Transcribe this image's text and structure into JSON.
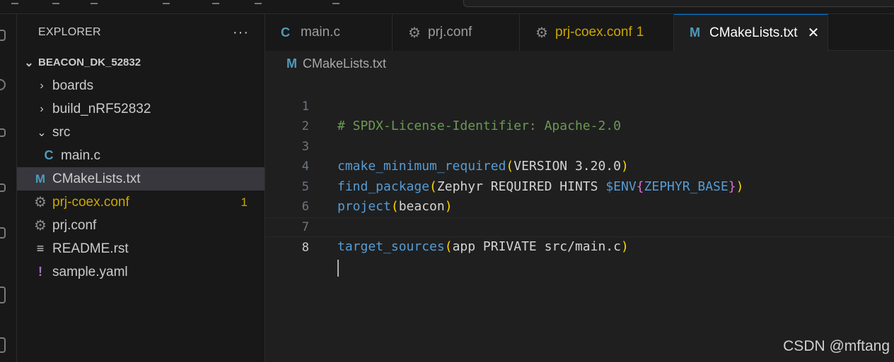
{
  "explorer": {
    "title": "EXPLORER",
    "more": "···",
    "root": "BEACON_DK_52832",
    "items": [
      {
        "label": "boards",
        "type": "folder",
        "state": "collapsed"
      },
      {
        "label": "build_nRF52832",
        "type": "folder",
        "state": "collapsed"
      },
      {
        "label": "src",
        "type": "folder",
        "state": "expanded"
      },
      {
        "label": "main.c",
        "type": "c-file",
        "icon": "C"
      },
      {
        "label": "CMakeLists.txt",
        "type": "cmake-file",
        "icon": "M",
        "selected": true
      },
      {
        "label": "prj-coex.conf",
        "type": "config-file",
        "badge": "1",
        "modified": true
      },
      {
        "label": "prj.conf",
        "type": "config-file"
      },
      {
        "label": "README.rst",
        "type": "text-file"
      },
      {
        "label": "sample.yaml",
        "type": "yaml-file",
        "icon": "!"
      }
    ]
  },
  "tabs": [
    {
      "label": "main.c",
      "icon": "C"
    },
    {
      "label": "prj.conf",
      "icon": "gear-icon"
    },
    {
      "label": "prj-coex.conf",
      "icon": "gear-icon",
      "badge": "1",
      "modified": true
    },
    {
      "label": "CMakeLists.txt",
      "icon": "M",
      "active": true,
      "close": "✕"
    }
  ],
  "breadcrumb": {
    "icon": "M",
    "file": "CMakeLists.txt"
  },
  "code": {
    "line_numbers": [
      "1",
      "2",
      "3",
      "4",
      "5",
      "6",
      "7",
      "8"
    ],
    "current_line": 8,
    "lines": [
      [
        "# SPDX-License-Identifier: Apache-2.0"
      ],
      [
        ""
      ],
      [
        "cmake_minimum_required",
        "(",
        "VERSION 3.20.0",
        ")"
      ],
      [
        "find_package",
        "(",
        "Zephyr REQUIRED HINTS ",
        "$ENV",
        "{",
        "ZEPHYR_BASE",
        "}",
        ")"
      ],
      [
        "project",
        "(",
        "beacon",
        ")"
      ],
      [
        ""
      ],
      [
        "target_sources",
        "(",
        "app PRIVATE src/main.c",
        ")"
      ],
      [
        ""
      ]
    ]
  },
  "watermark": "CSDN @mftang",
  "colors": {
    "accent": "#0078d4",
    "modified": "#cca700",
    "c_icon": "#519aba",
    "cmake_icon": "#519aba",
    "yaml_icon": "#a074c4",
    "comment": "#6a9955",
    "function": "#569cd6",
    "bracket1": "#ffd700",
    "bracket2": "#da70d6"
  }
}
